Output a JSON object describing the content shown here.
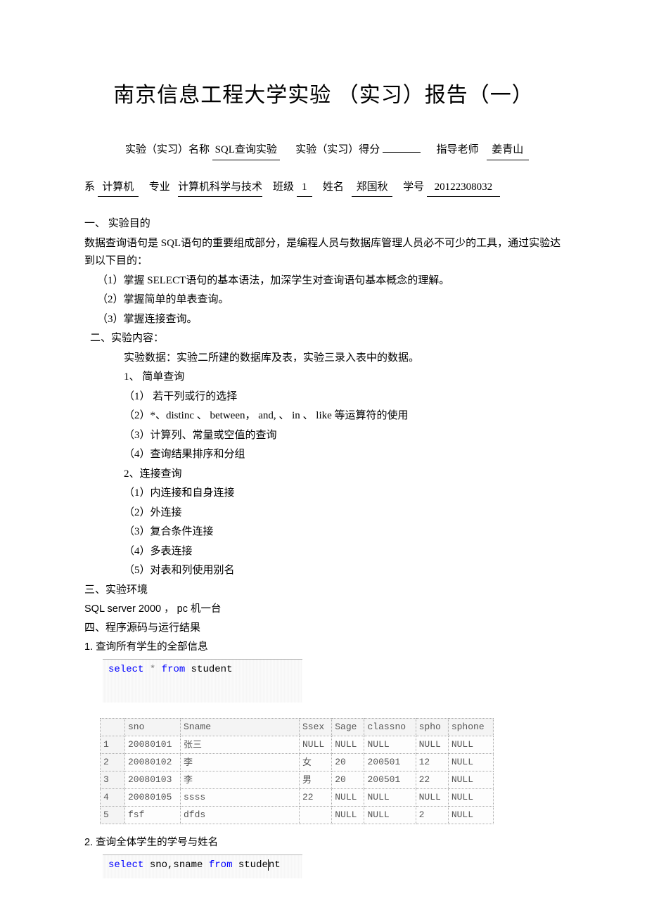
{
  "title": "南京信息工程大学实验 （实习）报告（一）",
  "meta": {
    "name_label": "实验（实习）名称",
    "name_value": "SQL查询实验",
    "score_label": "实验（实习）得分",
    "score_value": "",
    "teacher_label": "指导老师",
    "teacher_value": "姜青山",
    "dept_label": "系",
    "dept_value": "计算机",
    "major_label": "专业",
    "major_value": "计算机科学与技术",
    "class_label": "班级",
    "class_value": "1",
    "stuname_label": "姓名",
    "stuname_value": "郑国秋",
    "sno_label": "学号",
    "sno_value": "20122308032"
  },
  "sections": {
    "s1_h": "一、 实验目的",
    "s1_p1": "数据查询语句是   SQL语句的重要组成部分，是编程人员与数据库管理人员必不可少的工具，通过实验达到以下目的：",
    "s1_i1": "（1）掌握 SELECT语句的基本语法，加深学生对查询语句基本概念的理解。",
    "s1_i2": "（2）掌握简单的单表查询。",
    "s1_i3": "（3）掌握连接查询。",
    "s2_h": "二、实验内容：",
    "s2_p1": "实验数据：实验二所建的数据库及表，实验三录入表中的数据。",
    "s2_q1_h": "1、  简单查询",
    "s2_q1_1": "（1）  若干列或行的选择",
    "s2_q1_2": "（2）*、distinc  、 between， and,   、 in 、 like   等运算符的使用",
    "s2_q1_3": "（3）计算列、常量或空值的查询",
    "s2_q1_4": "（4）查询结果排序和分组",
    "s2_q2_h": "2、连接查询",
    "s2_q2_1": "（1）内连接和自身连接",
    "s2_q2_2": "（2）外连接",
    "s2_q2_3": "（3）复合条件连接",
    "s2_q2_4": "（4）多表连接",
    "s2_q2_5": "（5）对表和列使用别名",
    "s3_h": "三、实验环境",
    "s3_p1": "SQL server 2000  ， pc 机一台",
    "s4_h": "四、程序源码与运行结果",
    "s4_q1": "1. 查询所有学生的全部信息",
    "s4_q2": "2.  查询全体学生的学号与姓名"
  },
  "sql": {
    "q1": {
      "select": "select",
      "star": "*",
      "from": "from",
      "tbl": "student"
    },
    "q2": {
      "select": "select",
      "cols": "sno,sname",
      "from": "from",
      "tbl": "stude",
      "caret": "n",
      "tail": "t"
    }
  },
  "table1": {
    "headers": [
      "",
      "sno",
      "Sname",
      "Ssex",
      "Sage",
      "classno",
      "spho",
      "sphone"
    ],
    "rows": [
      [
        "1",
        "20080101",
        "张三",
        "NULL",
        "NULL",
        "NULL",
        "NULL",
        "NULL"
      ],
      [
        "2",
        "20080102",
        "李",
        "女",
        "20",
        "200501",
        "12",
        "NULL"
      ],
      [
        "3",
        "20080103",
        "李",
        "男",
        "20",
        "200501",
        "22",
        "NULL"
      ],
      [
        "4",
        "20080105",
        "ssss",
        "22",
        "NULL",
        "NULL",
        "NULL",
        "NULL"
      ],
      [
        "5",
        "fsf",
        "dfds",
        "",
        "NULL",
        "NULL",
        "2",
        "NULL"
      ]
    ]
  }
}
